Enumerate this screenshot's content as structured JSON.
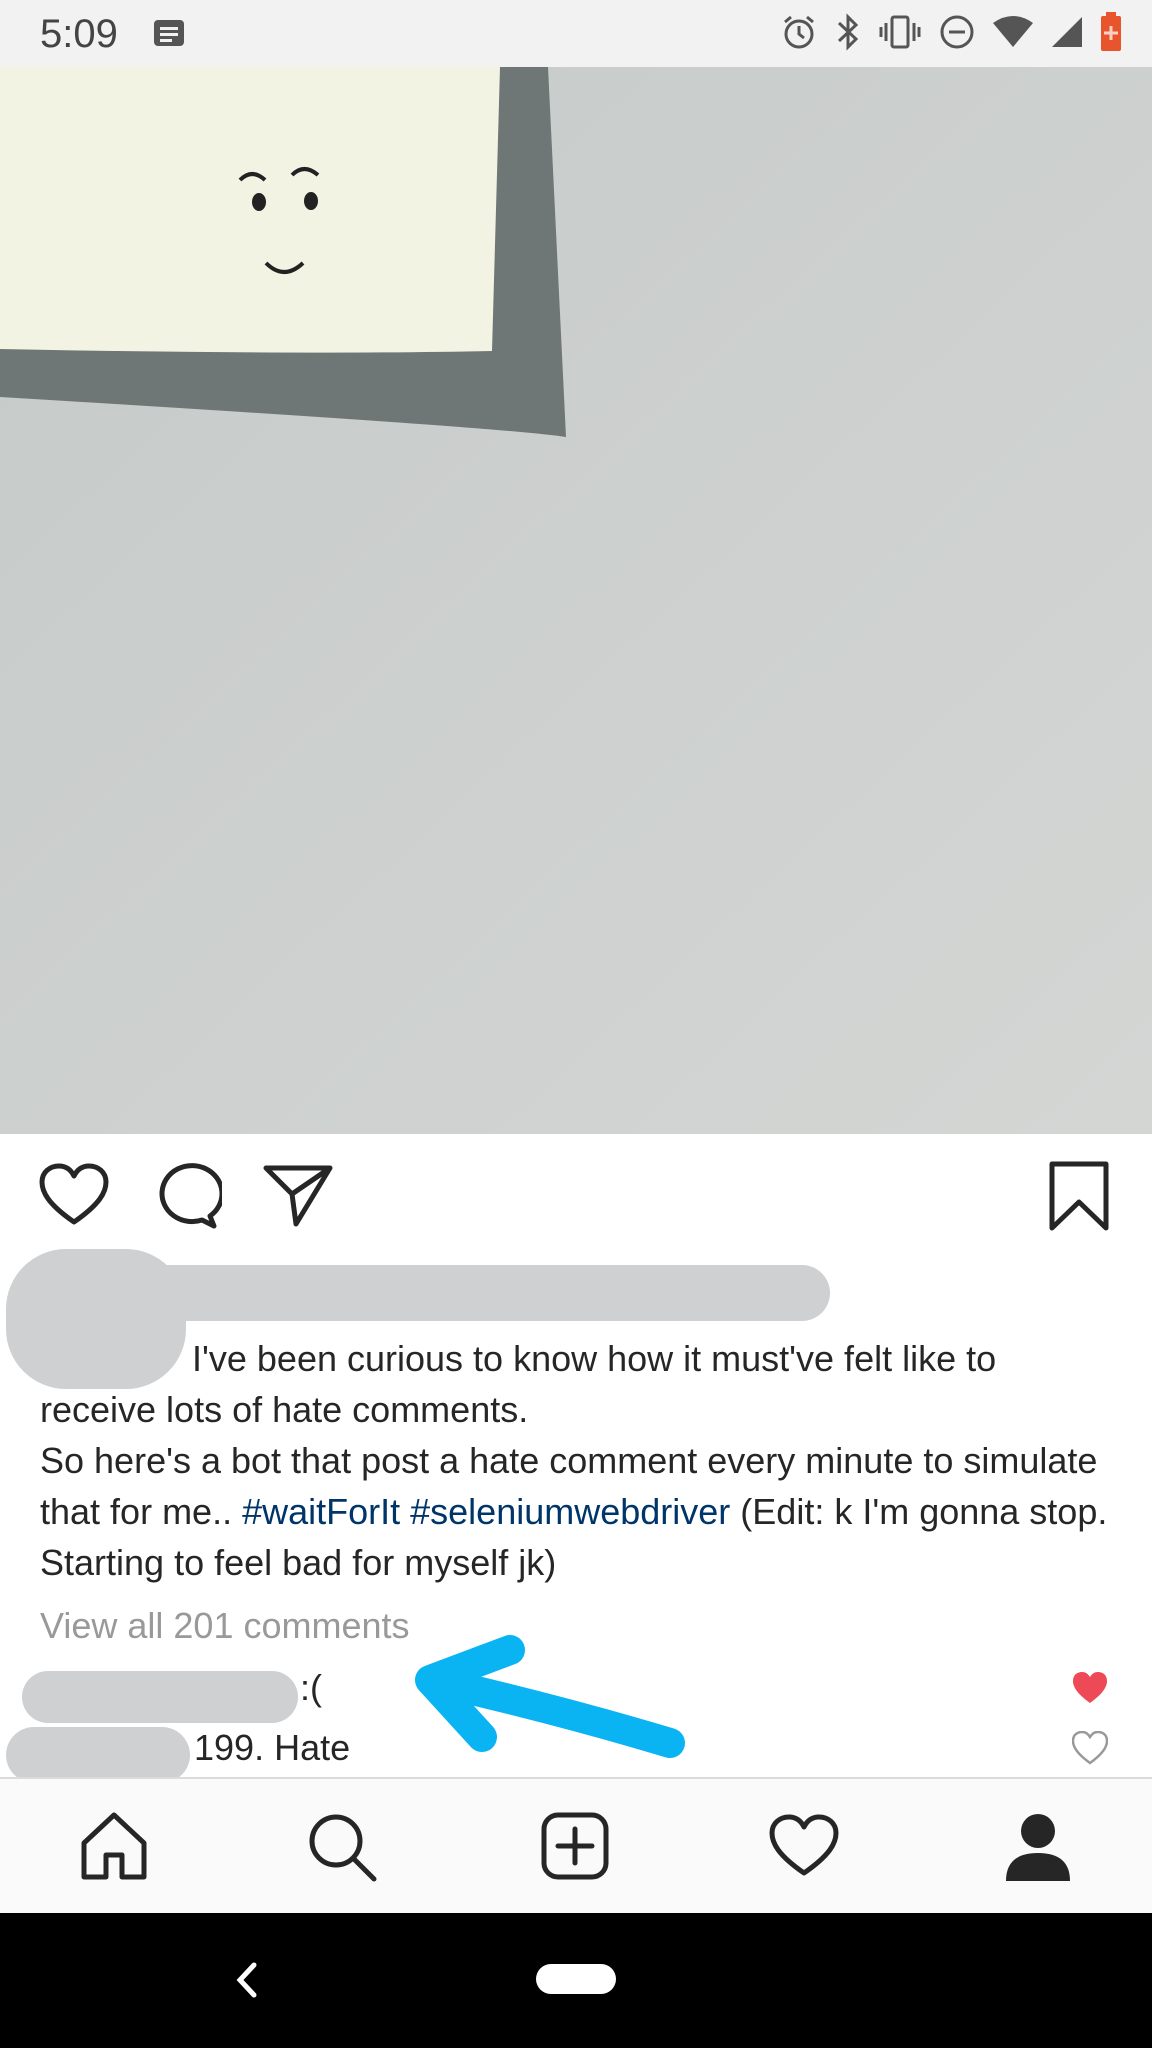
{
  "status_bar": {
    "time": "5:09",
    "icons": [
      "notification-icon",
      "alarm-icon",
      "bluetooth-icon",
      "vibrate-icon",
      "dnd-icon",
      "wifi-icon",
      "signal-icon",
      "battery-icon"
    ],
    "battery_color": "#e8542c"
  },
  "post": {
    "photo_description_icon": "sticky-note-face",
    "actions": [
      "like-icon",
      "comment-icon",
      "share-icon",
      "bookmark-icon"
    ],
    "caption": {
      "line1": "I've been curious to know how it must've felt like to receive lots of hate comments.",
      "line2_prefix": "So here's a bot that post a hate comment every minute to simulate that for me.. ",
      "hashtag1": "#waitForIt",
      "hashtag2": "#seleniumwebdriver",
      "line2_suffix": " (Edit: k I'm gonna stop. Starting to feel bad for myself jk)"
    },
    "view_all_comments": "View all 201 comments",
    "comments": [
      {
        "text": ":(",
        "liked": true
      },
      {
        "text": "199. Hate",
        "liked": false
      }
    ],
    "colors": {
      "hashtag": "#003569",
      "liked_heart": "#ed4956",
      "muted": "#999999",
      "arrow": "#0ab4f3"
    }
  },
  "bottom_nav": [
    "home-icon",
    "search-icon",
    "new-post-icon",
    "activity-icon",
    "profile-icon"
  ]
}
